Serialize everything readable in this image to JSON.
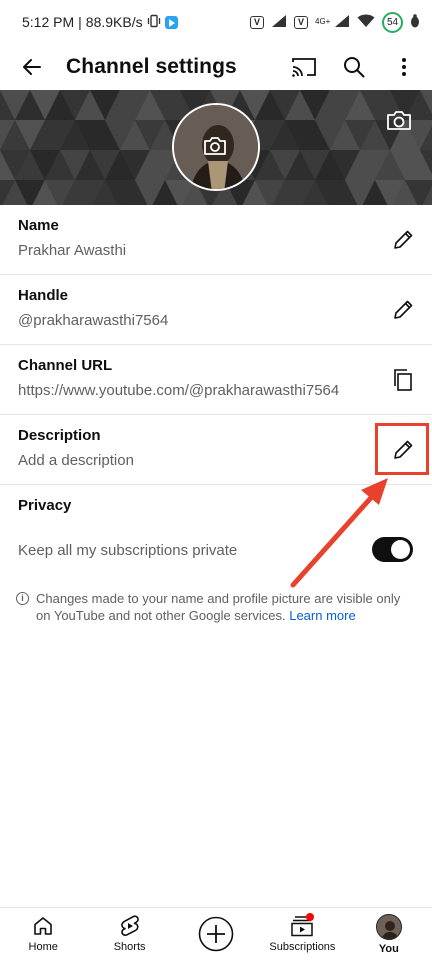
{
  "status_bar": {
    "time": "5:12 PM",
    "speed": "88.9KB/s",
    "network": "4G+",
    "battery": "54"
  },
  "header": {
    "title": "Channel settings"
  },
  "fields": {
    "name": {
      "label": "Name",
      "value": "Prakhar Awasthi"
    },
    "handle": {
      "label": "Handle",
      "value": "@prakharawasthi7564"
    },
    "channel_url": {
      "label": "Channel URL",
      "value": "https://www.youtube.com/@prakharawasthi7564"
    },
    "description": {
      "label": "Description",
      "value": "Add a description"
    }
  },
  "privacy": {
    "title": "Privacy",
    "toggle_label": "Keep all my subscriptions private",
    "toggle_on": true
  },
  "info": {
    "text": "Changes made to your name and profile picture are visible only on YouTube and not other Google services.",
    "link": "Learn more"
  },
  "bottom_nav": {
    "home": "Home",
    "shorts": "Shorts",
    "subscriptions": "Subscriptions",
    "you": "You"
  },
  "colors": {
    "annotation": "#e8412c",
    "link": "#065fd4",
    "toggle_track": "#0f0f0f",
    "badge": "#ff0000"
  }
}
